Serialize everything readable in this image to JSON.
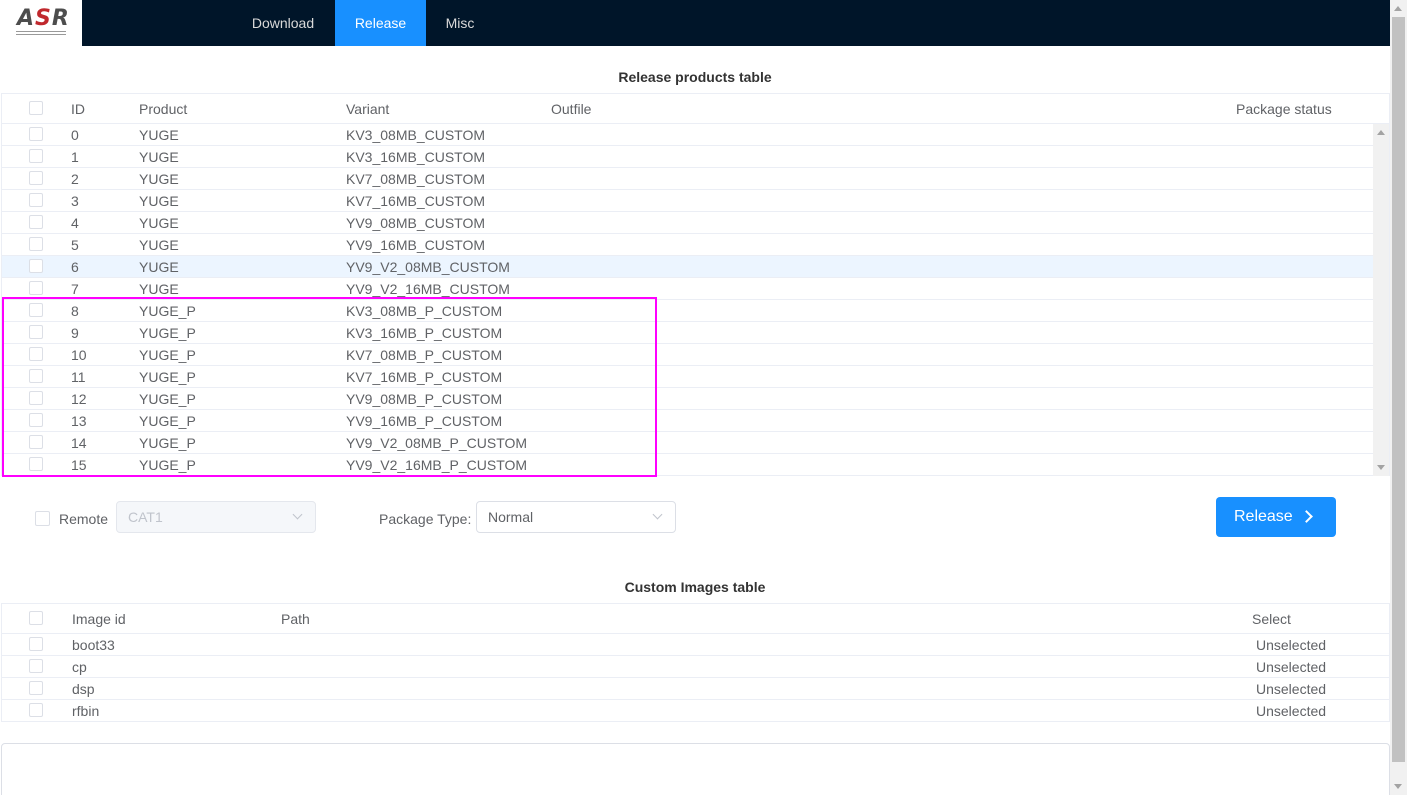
{
  "app": {
    "logo_text_a": "A",
    "logo_text_s": "S",
    "logo_text_r": "R"
  },
  "nav": {
    "tabs": [
      {
        "label": "Download"
      },
      {
        "label": "Release"
      },
      {
        "label": "Misc"
      }
    ],
    "active": "Release"
  },
  "products_table": {
    "title": "Release products table",
    "columns": {
      "id": "ID",
      "product": "Product",
      "variant": "Variant",
      "outfile": "Outfile",
      "status": "Package status"
    },
    "rows": [
      {
        "id": "0",
        "product": "YUGE",
        "variant": "KV3_08MB_CUSTOM"
      },
      {
        "id": "1",
        "product": "YUGE",
        "variant": "KV3_16MB_CUSTOM"
      },
      {
        "id": "2",
        "product": "YUGE",
        "variant": "KV7_08MB_CUSTOM"
      },
      {
        "id": "3",
        "product": "YUGE",
        "variant": "KV7_16MB_CUSTOM"
      },
      {
        "id": "4",
        "product": "YUGE",
        "variant": "YV9_08MB_CUSTOM"
      },
      {
        "id": "5",
        "product": "YUGE",
        "variant": "YV9_16MB_CUSTOM"
      },
      {
        "id": "6",
        "product": "YUGE",
        "variant": "YV9_V2_08MB_CUSTOM"
      },
      {
        "id": "7",
        "product": "YUGE",
        "variant": "YV9_V2_16MB_CUSTOM"
      },
      {
        "id": "8",
        "product": "YUGE_P",
        "variant": "KV3_08MB_P_CUSTOM"
      },
      {
        "id": "9",
        "product": "YUGE_P",
        "variant": "KV3_16MB_P_CUSTOM"
      },
      {
        "id": "10",
        "product": "YUGE_P",
        "variant": "KV7_08MB_P_CUSTOM"
      },
      {
        "id": "11",
        "product": "YUGE_P",
        "variant": "KV7_16MB_P_CUSTOM"
      },
      {
        "id": "12",
        "product": "YUGE_P",
        "variant": "YV9_08MB_P_CUSTOM"
      },
      {
        "id": "13",
        "product": "YUGE_P",
        "variant": "YV9_16MB_P_CUSTOM"
      },
      {
        "id": "14",
        "product": "YUGE_P",
        "variant": "YV9_V2_08MB_P_CUSTOM"
      },
      {
        "id": "15",
        "product": "YUGE_P",
        "variant": "YV9_V2_16MB_P_CUSTOM"
      }
    ],
    "hovered_row_id": "6",
    "highlight_color": "#ff00ff"
  },
  "controls": {
    "remote_label": "Remote",
    "remote_select_value": "CAT1",
    "package_type_label": "Package Type:",
    "package_type_value": "Normal",
    "release_button": "Release"
  },
  "images_table": {
    "title": "Custom Images table",
    "columns": {
      "image_id": "Image id",
      "path": "Path",
      "select": "Select"
    },
    "rows": [
      {
        "image_id": "boot33",
        "path": "",
        "select": "Unselected"
      },
      {
        "image_id": "cp",
        "path": "",
        "select": "Unselected"
      },
      {
        "image_id": "dsp",
        "path": "",
        "select": "Unselected"
      },
      {
        "image_id": "rfbin",
        "path": "",
        "select": "Unselected"
      }
    ]
  },
  "colors": {
    "header_bg": "#001529",
    "accent": "#1890ff"
  }
}
